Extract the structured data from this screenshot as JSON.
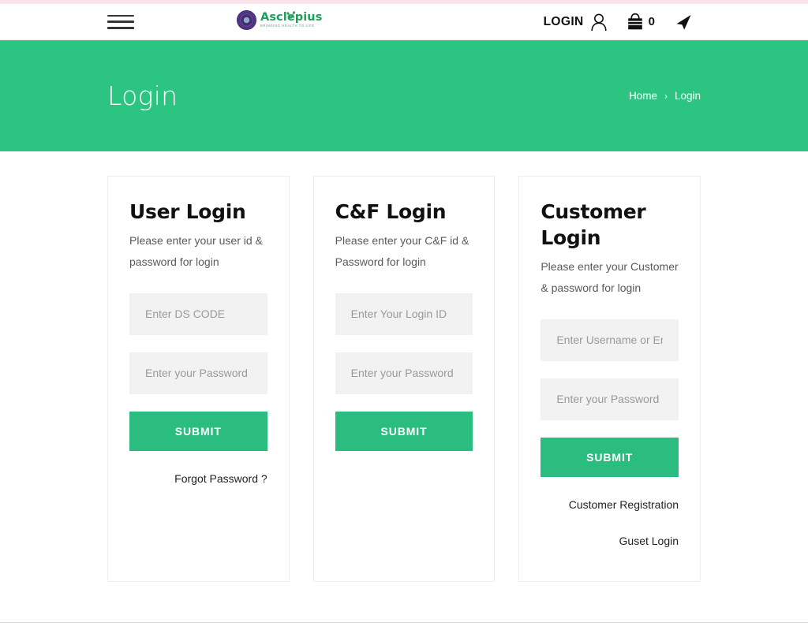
{
  "header": {
    "menu_icon": "hamburger-menu-icon",
    "logo": {
      "name": "Asclepius",
      "tagline": "BRINGING HEALTH TO LIFE",
      "seal_icon": "circular-seal-emblem-icon",
      "leaf_icon": "leaf-icon"
    },
    "login_label": "LOGIN",
    "user_icon": "user-icon",
    "bag_icon": "shopping-bag-icon",
    "cart_count": "0",
    "nav_icon": "navigation-arrow-icon"
  },
  "banner": {
    "title": "Login",
    "breadcrumb": {
      "home": "Home",
      "separator": "›",
      "current": "Login"
    }
  },
  "cards": [
    {
      "title": "User Login",
      "description": "Please enter your user id & password for login",
      "username_placeholder": "Enter DS CODE",
      "password_placeholder": "Enter your Password",
      "submit_label": "SUBMIT",
      "link_one": "Forgot Password ?",
      "link_two": ""
    },
    {
      "title": "C&F Login",
      "description": "Please enter your C&F id & Password for login",
      "username_placeholder": "Enter Your Login ID",
      "password_placeholder": "Enter your Password",
      "submit_label": "SUBMIT",
      "link_one": "",
      "link_two": ""
    },
    {
      "title": "Customer Login",
      "description": "Please enter your Customer & password for login",
      "username_placeholder": "Enter Username or Email",
      "password_placeholder": "Enter your Password",
      "submit_label": "SUBMIT",
      "link_one": "Customer Registration",
      "link_two": "Guset Login"
    }
  ],
  "colors": {
    "brand_green": "#2bc481",
    "button_green": "#2bbd80",
    "top_strip_pink": "#f7e3e8",
    "input_grey": "#f2f2f2",
    "logo_green": "#1f9d5a"
  }
}
